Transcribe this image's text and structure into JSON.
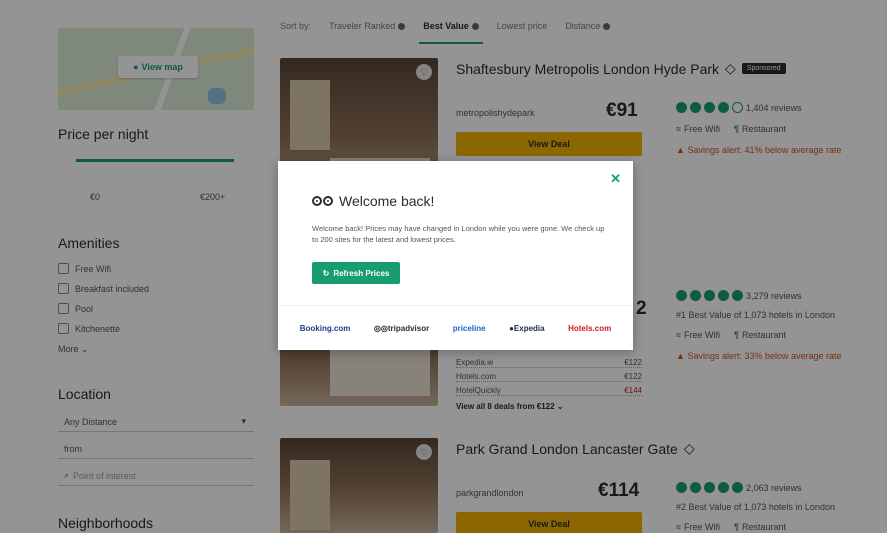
{
  "sidebar": {
    "map_button": "View map",
    "price_title": "Price per night",
    "price_min": "€0",
    "price_max": "€200+",
    "amenities_title": "Amenities",
    "amenities": [
      "Free Wifi",
      "Breakfast included",
      "Pool",
      "Kitchenette"
    ],
    "more": "More",
    "location_title": "Location",
    "distance_select": "Any Distance",
    "from_label": "from",
    "poi_placeholder": "Point of interest",
    "neighborhoods_title": "Neighborhoods"
  },
  "sort": {
    "label": "Sort by:",
    "options": [
      "Traveler Ranked",
      "Best Value",
      "Lowest price",
      "Distance"
    ],
    "active": "Best Value"
  },
  "listings": [
    {
      "name": "Shaftesbury Metropolis London Hyde Park",
      "sponsored": "Sponsored",
      "site": "metropolishydepark",
      "price": "€91",
      "deal_label": "View Deal",
      "reviews": "1,404 reviews",
      "rating_bubbles": 4,
      "features": [
        "Free Wifi",
        "Restaurant"
      ],
      "savings": "Savings alert: 41% below average rate"
    },
    {
      "price_partial": "2",
      "reviews": "3,279 reviews",
      "rating_bubbles": 5,
      "best_value": "#1 Best Value of 1,073 hotels in London",
      "features": [
        "Free Wifi",
        "Restaurant"
      ],
      "savings": "Savings alert: 33% below average rate",
      "deals": [
        {
          "site": "Expedia.ie",
          "price": "€122",
          "highlight": false
        },
        {
          "site": "Hotels.com",
          "price": "€122",
          "highlight": false
        },
        {
          "site": "HotelQuickly",
          "price": "€144",
          "highlight": true
        }
      ],
      "view_all": "View all 8 deals from €122"
    },
    {
      "name": "Park Grand London Lancaster Gate",
      "site": "parkgrandlondon",
      "price": "€114",
      "deal_label": "View Deal",
      "reviews": "2,063 reviews",
      "rating_bubbles": 5,
      "best_value": "#2 Best Value of 1,073 hotels in London",
      "features": [
        "Free Wifi",
        "Restaurant"
      ]
    }
  ],
  "modal": {
    "title": "Welcome back!",
    "text": "Welcome back! Prices may have changed in London while you were gone. We check up to 200 sites for the latest and lowest prices.",
    "refresh_label": "Refresh Prices",
    "close_icon": "close-icon",
    "partners": {
      "booking": "Booking.com",
      "tripadvisor": "tripadvisor",
      "priceline": "priceline",
      "expedia": "Expedia",
      "hotels": "Hotels.com"
    }
  },
  "colors": {
    "accent": "#1a9c73",
    "deal_button": "#f2b203",
    "savings": "#c9531c"
  }
}
